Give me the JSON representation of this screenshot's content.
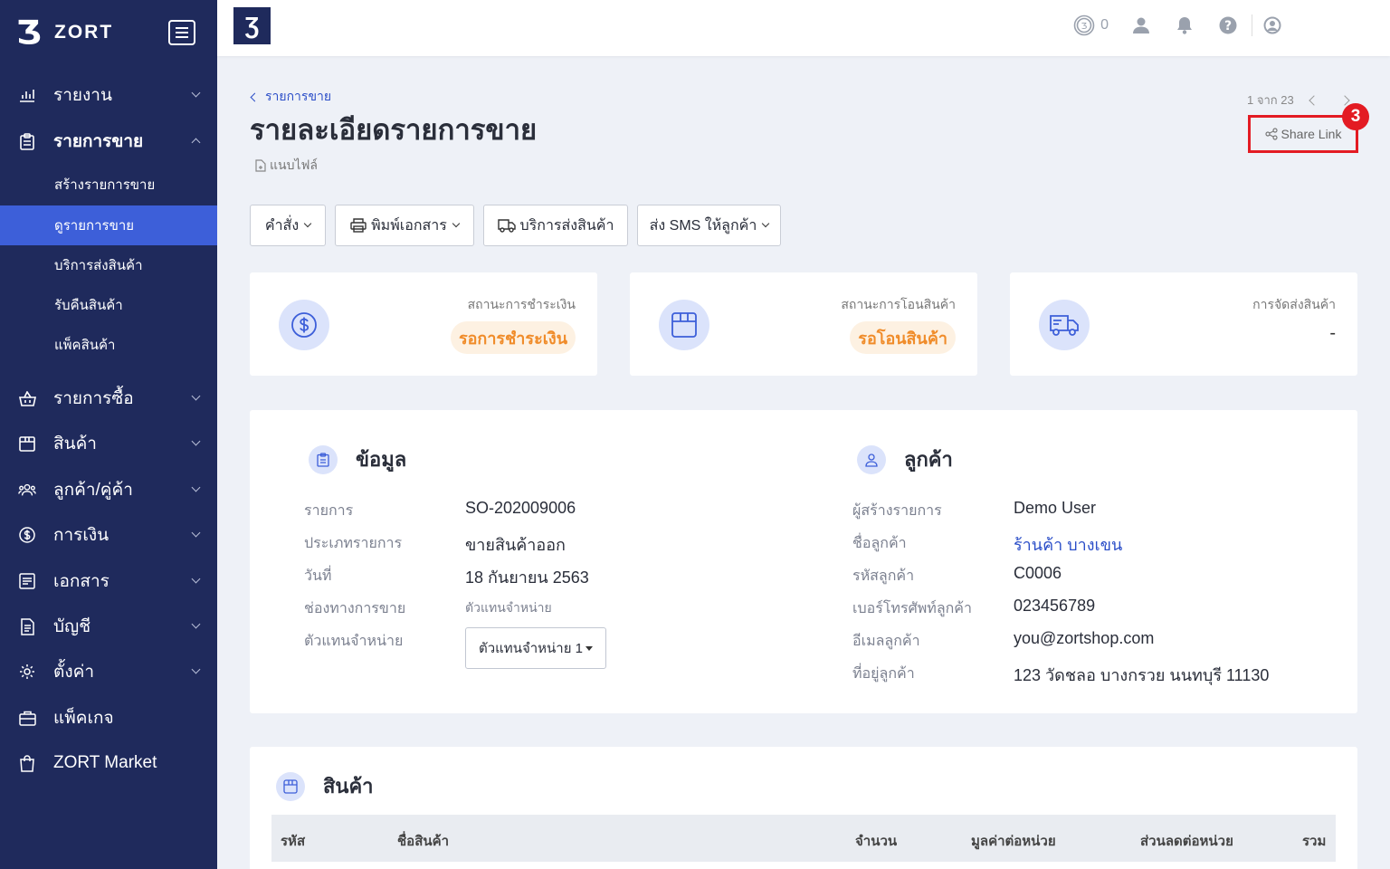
{
  "brand": {
    "name": "ZORT",
    "logo_glyph": "Ʒ"
  },
  "sidebar": {
    "items": [
      {
        "label": "รายงาน",
        "icon": "bar-chart-icon",
        "expanded": false
      },
      {
        "label": "รายการขาย",
        "icon": "clipboard-icon",
        "expanded": true,
        "children": [
          "สร้างรายการขาย",
          "ดูรายการขาย",
          "บริการส่งสินค้า",
          "รับคืนสินค้า",
          "แพ็คสินค้า"
        ],
        "active_child": "ดูรายการขาย"
      },
      {
        "label": "รายการซื้อ",
        "icon": "basket-icon",
        "expanded": false
      },
      {
        "label": "สินค้า",
        "icon": "box-icon",
        "expanded": false
      },
      {
        "label": "ลูกค้า/คู่ค้า",
        "icon": "users-icon",
        "expanded": false
      },
      {
        "label": "การเงิน",
        "icon": "dollar-icon",
        "expanded": false
      },
      {
        "label": "เอกสาร",
        "icon": "document-icon",
        "expanded": false
      },
      {
        "label": "บัญชี",
        "icon": "ledger-icon",
        "expanded": false
      },
      {
        "label": "ตั้งค่า",
        "icon": "gear-icon",
        "expanded": false
      },
      {
        "label": "แพ็คเกจ",
        "icon": "briefcase-icon"
      },
      {
        "label": "ZORT Market",
        "icon": "shopping-bag-icon"
      }
    ]
  },
  "topbar": {
    "coin_count": "0"
  },
  "header": {
    "breadcrumb": "รายการขาย",
    "title": "รายละเอียดรายการขาย",
    "file_link": "แนบไฟล์",
    "pager": "1 จาก 23",
    "share_label": "Share Link",
    "step_badge": "3"
  },
  "actions": {
    "command": "คำสั่ง",
    "print": "พิมพ์เอกสาร",
    "shipping": "บริการส่งสินค้า",
    "sms": "ส่ง SMS ให้ลูกค้า"
  },
  "status": {
    "payment": {
      "label": "สถานะการชำระเงิน",
      "value": "รอการชำระเงิน"
    },
    "transfer": {
      "label": "สถานะการโอนสินค้า",
      "value": "รอโอนสินค้า"
    },
    "delivery": {
      "label": "การจัดส่งสินค้า",
      "value": "-"
    }
  },
  "info": {
    "title": "ข้อมูล",
    "rows": [
      {
        "label": "รายการ",
        "value": "SO-202009006"
      },
      {
        "label": "ประเภทรายการ",
        "value": "ขายสินค้าออก"
      },
      {
        "label": "วันที่",
        "value": "18 กันยายน 2563"
      },
      {
        "label": "ช่องทางการขาย",
        "value": "ตัวแทนจำหน่าย"
      },
      {
        "label": "ตัวแทนจำหน่าย",
        "value": "ตัวแทนจำหน่าย 1"
      }
    ]
  },
  "customer": {
    "title": "ลูกค้า",
    "rows": [
      {
        "label": "ผู้สร้างรายการ",
        "value": "Demo User"
      },
      {
        "label": "ชื่อลูกค้า",
        "value": "ร้านค้า บางเขน"
      },
      {
        "label": "รหัสลูกค้า",
        "value": "C0006"
      },
      {
        "label": "เบอร์โทรศัพท์ลูกค้า",
        "value": "023456789"
      },
      {
        "label": "อีเมลลูกค้า",
        "value": "you@zortshop.com"
      },
      {
        "label": "ที่อยู่ลูกค้า",
        "value": "123 วัดชลอ บางกรวย นนทบุรี 11130"
      }
    ]
  },
  "products": {
    "title": "สินค้า",
    "columns": [
      "รหัส",
      "ชื่อสินค้า",
      "จำนวน",
      "มูลค่าต่อหน่วย",
      "ส่วนลดต่อหน่วย",
      "รวม"
    ]
  },
  "colors": {
    "sidebar": "#1f2a5c",
    "accent": "#3d5fd9",
    "highlight": "#e31b23",
    "pending": "#f08c2a"
  }
}
